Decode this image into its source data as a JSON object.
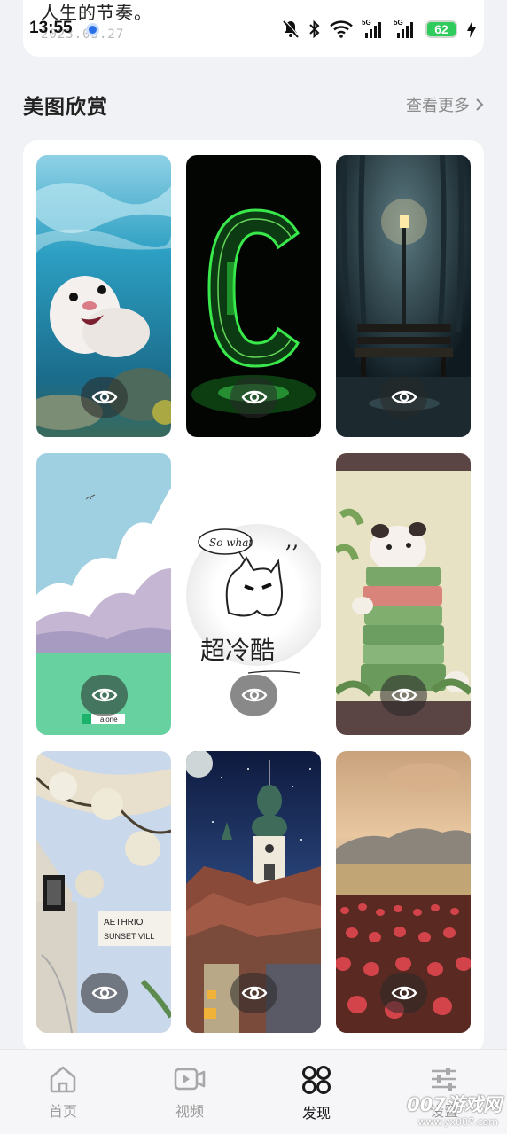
{
  "top_card": {
    "text": "人生的节奏。",
    "date": "2023.03.27"
  },
  "status_bar": {
    "time": "13:55",
    "network_1": "5G",
    "network_2": "5G",
    "battery": "62"
  },
  "section": {
    "title": "美图欣赏",
    "see_more": "查看更多"
  },
  "gallery": {
    "tiles": [
      {
        "subject": "white ferret swimming underwater"
      },
      {
        "subject": "green neon letter C"
      },
      {
        "subject": "park bench under lamppost at night"
      },
      {
        "subject": "clouds over green field",
        "caption": "alone"
      },
      {
        "subject": "cat sketch",
        "bubble": "So what",
        "caption": "超冷酷"
      },
      {
        "subject": "panda on stacked blocks"
      },
      {
        "subject": "flowering branch and wall lantern",
        "sign_line1": "AETHRIO",
        "sign_line2": "SUNSET VILL"
      },
      {
        "subject": "church tower over rooftops at night"
      },
      {
        "subject": "tulip field at sunset"
      }
    ]
  },
  "bottom_nav": {
    "items": [
      {
        "label": "首页",
        "icon": "home-icon"
      },
      {
        "label": "视频",
        "icon": "video-icon"
      },
      {
        "label": "发现",
        "icon": "discover-icon"
      },
      {
        "label": "设置",
        "icon": "settings-icon"
      }
    ],
    "active_index": 2
  },
  "watermark": {
    "text": "007游戏网",
    "url": "www.yx007.com"
  }
}
